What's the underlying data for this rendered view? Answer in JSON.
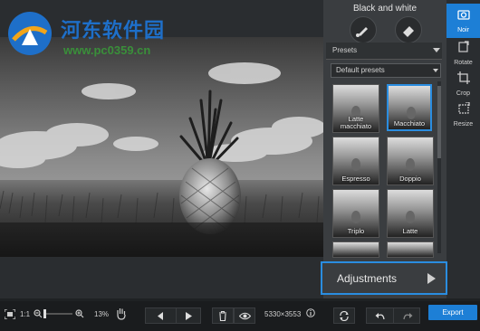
{
  "watermark": {
    "title": "河东软件园",
    "url": "www.pc0359.cn"
  },
  "panel": {
    "title": "Black and white",
    "presets_label": "Presets",
    "dropdown_value": "Default presets",
    "thumbnails": [
      {
        "label": "Latte macchiato",
        "selected": false
      },
      {
        "label": "Macchiato",
        "selected": true
      },
      {
        "label": "Espresso",
        "selected": false
      },
      {
        "label": "Doppio",
        "selected": false
      },
      {
        "label": "Triplo",
        "selected": false
      },
      {
        "label": "Latte",
        "selected": false
      },
      {
        "label": "",
        "selected": false
      },
      {
        "label": "",
        "selected": false
      }
    ],
    "adjustments_label": "Adjustments"
  },
  "right_tools": [
    {
      "label": "Noir",
      "icon": "camera-icon",
      "active": true
    },
    {
      "label": "Rotate",
      "icon": "rotate-icon",
      "active": false
    },
    {
      "label": "Crop",
      "icon": "crop-icon",
      "active": false
    },
    {
      "label": "Resize",
      "icon": "resize-icon",
      "active": false
    }
  ],
  "bottom_bar": {
    "ratio_label": "1:1",
    "zoom_percent": "13%",
    "zoom_level": 0.13,
    "dimensions": "5330×3553",
    "export_label": "Export"
  },
  "colors": {
    "accent": "#2a8de0",
    "export": "#1d7fd6",
    "watermark_title": "#1e6fc9",
    "watermark_url": "#3a8f3a"
  }
}
